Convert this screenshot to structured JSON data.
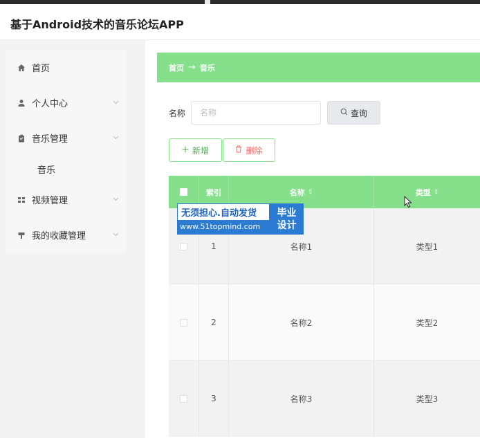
{
  "app": {
    "title": "基于Android技术的音乐论坛APP"
  },
  "sidebar": {
    "items": [
      {
        "label": "首页",
        "icon": "home-icon",
        "has_children": false
      },
      {
        "label": "个人中心",
        "icon": "user-icon",
        "has_children": true
      },
      {
        "label": "音乐管理",
        "icon": "clipboard-icon",
        "has_children": true
      },
      {
        "label": "视频管理",
        "icon": "grid-icon",
        "has_children": true
      },
      {
        "label": "我的收藏管理",
        "icon": "bookmark-icon",
        "has_children": true
      }
    ],
    "submenu": {
      "label": "音乐"
    }
  },
  "breadcrumb": {
    "home": "首页",
    "separator": "→",
    "current": "音乐"
  },
  "search": {
    "label": "名称",
    "placeholder": "名称",
    "button_label": "查询"
  },
  "actions": {
    "add_label": "新增",
    "delete_label": "删除"
  },
  "table": {
    "columns": {
      "index": "索引",
      "name": "名称",
      "type": "类型"
    },
    "rows": [
      {
        "index": "1",
        "name": "名称1",
        "type": "类型1"
      },
      {
        "index": "2",
        "name": "名称2",
        "type": "类型2"
      },
      {
        "index": "3",
        "name": "名称3",
        "type": "类型3"
      }
    ]
  },
  "watermark": {
    "slogan": "无须担心.自动发货",
    "url": "www.51topmind.com",
    "badge_line1": "毕业",
    "badge_line2": "设计"
  },
  "colors": {
    "accent": "#86df8b",
    "danger": "#f56c6c",
    "watermark_blue": "#2b7bd3"
  }
}
